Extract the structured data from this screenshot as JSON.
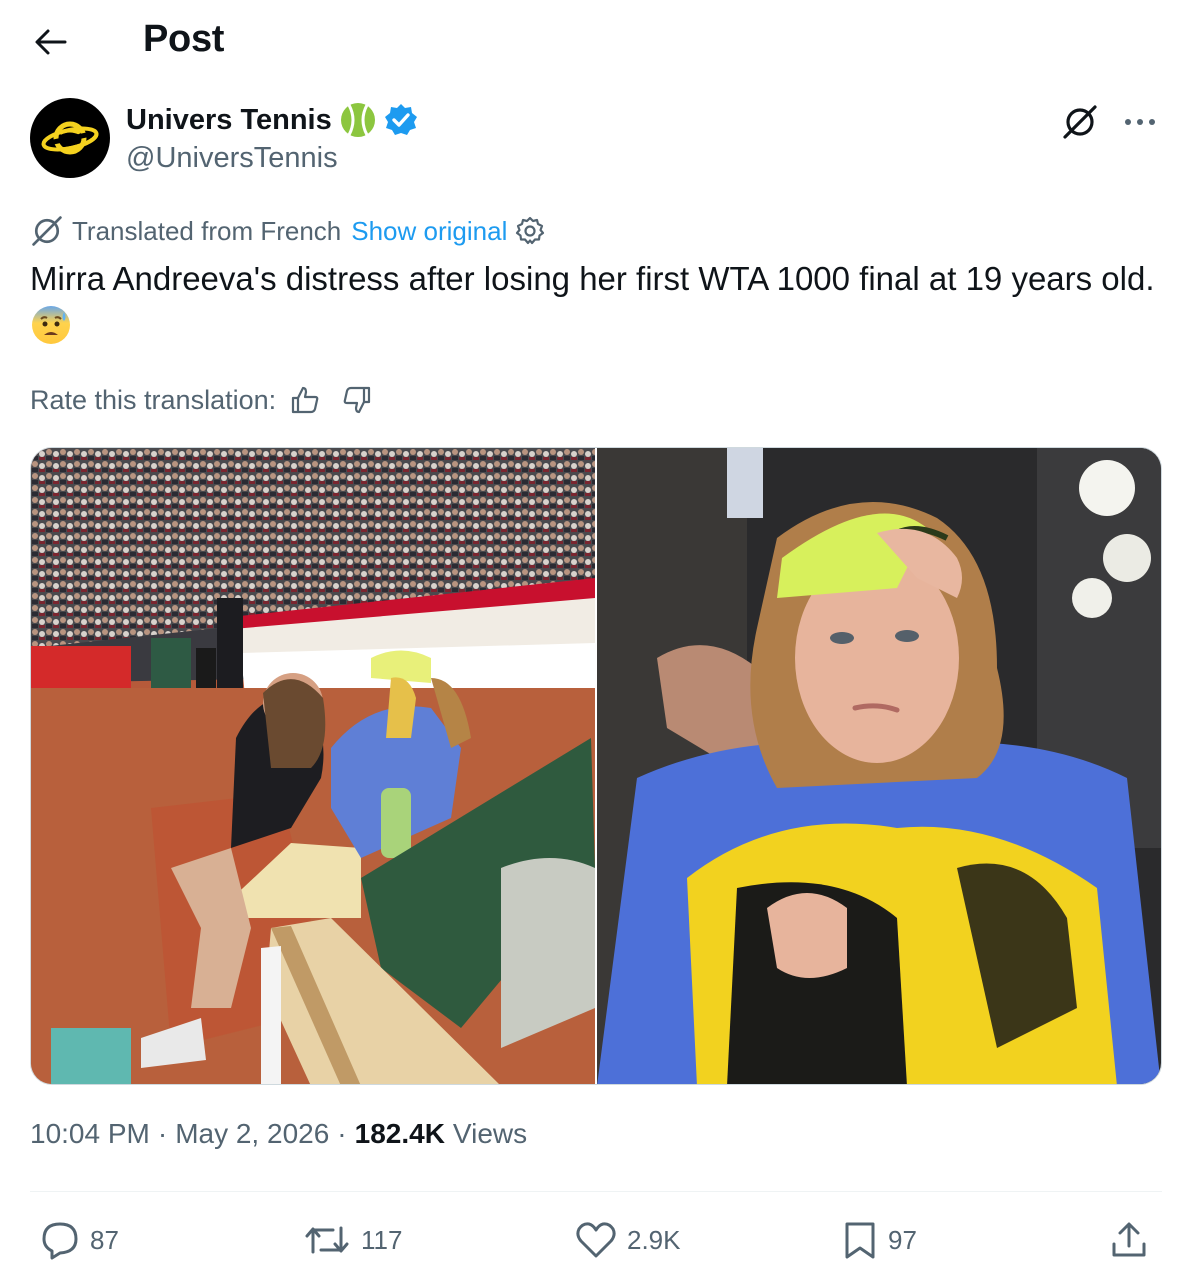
{
  "header": {
    "title": "Post",
    "back_icon": "arrow-left-icon"
  },
  "author": {
    "name": "Univers Tennis",
    "handle": "@UniversTennis",
    "verified": true,
    "badge_colors": {
      "tennis_ball": "#8cc63f",
      "verified": "#1d9bf0"
    },
    "avatar_colors": {
      "bg": "#000000",
      "logo": "#f5d21f"
    }
  },
  "translation": {
    "label": "Translated from French",
    "show_original": "Show original"
  },
  "tweet": {
    "text": "Mirra Andreeva's distress after losing her first WTA 1000 final at 19 years old.",
    "emoji": "😰"
  },
  "rate": {
    "label": "Rate this translation:"
  },
  "meta": {
    "time": "10:04 PM",
    "date": "May 2, 2026",
    "views_count": "182.4K",
    "views_label": "Views"
  },
  "actions": {
    "replies": "87",
    "reposts": "117",
    "likes": "2.9K",
    "bookmarks": "97"
  },
  "colors": {
    "text": "#0f1419",
    "muted": "#536471",
    "link": "#1d9bf0",
    "border": "#cfd9de"
  }
}
